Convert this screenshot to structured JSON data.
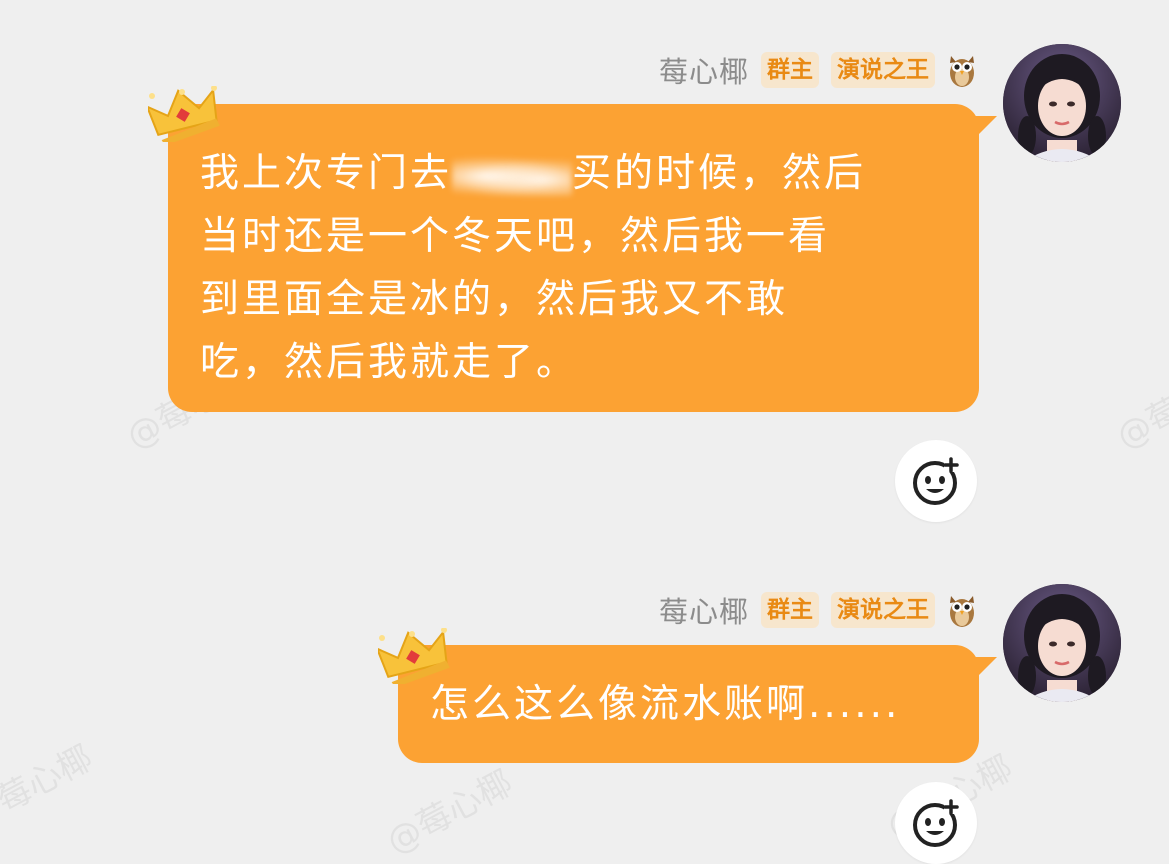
{
  "watermark": "@莓心椰",
  "messages": [
    {
      "username": "莓心椰",
      "tags": [
        "群主",
        "演说之王"
      ],
      "badge_icon": "owl-icon",
      "crown_icon": "crown-icon",
      "lines": [
        "我上次专门去",
        "买的时候，然后",
        "当时还是一个冬天吧，然后我一看",
        "到里面全是冰的，然后我又不敢",
        "吃，然后我就走了。"
      ],
      "react_icon": "add-emoji-icon"
    },
    {
      "username": "莓心椰",
      "tags": [
        "群主",
        "演说之王"
      ],
      "badge_icon": "owl-icon",
      "crown_icon": "crown-icon",
      "lines": [
        "怎么这么像流水账啊......"
      ],
      "react_icon": "add-emoji-icon"
    }
  ],
  "colors": {
    "bubble": "#fca233",
    "tag_bg": "#f7e6cd",
    "tag_text": "#e98a14",
    "username": "#8c8c8c",
    "background": "#efefef"
  }
}
